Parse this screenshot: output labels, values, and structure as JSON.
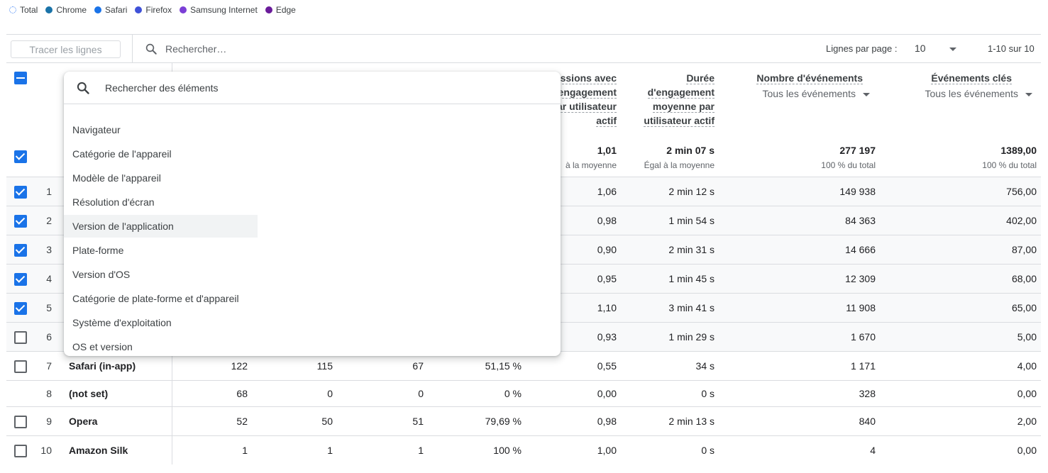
{
  "legend": [
    {
      "label": "Total",
      "color": "#4285f4",
      "style": "dotted"
    },
    {
      "label": "Chrome",
      "color": "#1a73a8"
    },
    {
      "label": "Safari",
      "color": "#1a73e8"
    },
    {
      "label": "Firefox",
      "color": "#3f51d8"
    },
    {
      "label": "Samsung Internet",
      "color": "#7b3fd6"
    },
    {
      "label": "Edge",
      "color": "#6a1b9a"
    }
  ],
  "toolbar": {
    "plot_rows_label": "Tracer les lignes",
    "search_placeholder": "Rechercher…",
    "rows_per_page_label": "Lignes par page :",
    "rows_per_page_value": "10",
    "pagination": "1-10 sur 10"
  },
  "columns": {
    "sessions_per_user": {
      "line1": "essions avec",
      "line2": "engagement",
      "line3": "ar utilisateur",
      "line4": "actif"
    },
    "avg_engagement": {
      "line1": "Durée",
      "line2": "d'engagement",
      "line3": "moyenne par",
      "line4": "utilisateur actif"
    },
    "event_count": {
      "title": "Nombre d'événements",
      "filter": "Tous les événements"
    },
    "key_events": {
      "title": "Événements clés",
      "filter": "Tous les événements"
    }
  },
  "totals": {
    "sessions_per_user": "1,01",
    "sessions_per_user_sub": "à la moyenne",
    "avg_engagement": "2 min 07 s",
    "avg_engagement_sub": "Égal à la moyenne",
    "event_count": "277 197",
    "event_count_sub": "100 % du total",
    "key_events": "1389,00",
    "key_events_sub": "100 % du total"
  },
  "rows": [
    {
      "idx": "1",
      "checked": true,
      "name": "",
      "c1": "",
      "c2": "",
      "c3": "",
      "c4": "",
      "spu": "1,06",
      "eng": "2 min 12 s",
      "events": "149 938",
      "key": "756,00"
    },
    {
      "idx": "2",
      "checked": true,
      "name": "",
      "c1": "",
      "c2": "",
      "c3": "",
      "c4": "",
      "spu": "0,98",
      "eng": "1 min 54 s",
      "events": "84 363",
      "key": "402,00"
    },
    {
      "idx": "3",
      "checked": true,
      "name": "",
      "c1": "",
      "c2": "",
      "c3": "",
      "c4": "",
      "spu": "0,90",
      "eng": "2 min 31 s",
      "events": "14 666",
      "key": "87,00"
    },
    {
      "idx": "4",
      "checked": true,
      "name": "",
      "c1": "",
      "c2": "",
      "c3": "",
      "c4": "",
      "spu": "0,95",
      "eng": "1 min 45 s",
      "events": "12 309",
      "key": "68,00"
    },
    {
      "idx": "5",
      "checked": true,
      "name": "",
      "c1": "",
      "c2": "",
      "c3": "",
      "c4": "",
      "spu": "1,10",
      "eng": "3 min 41 s",
      "events": "11 908",
      "key": "65,00"
    },
    {
      "idx": "6",
      "checked": false,
      "name": "",
      "c1": "",
      "c2": "",
      "c3": "",
      "c4": "",
      "spu": "0,93",
      "eng": "1 min 29 s",
      "events": "1 670",
      "key": "5,00"
    },
    {
      "idx": "7",
      "checked": false,
      "name": "Safari (in-app)",
      "c1": "122",
      "c2": "115",
      "c3": "67",
      "c4": "51,15 %",
      "spu": "0,55",
      "eng": "34 s",
      "events": "1 171",
      "key": "4,00"
    },
    {
      "idx": "8",
      "checked": null,
      "name": "(not set)",
      "c1": "68",
      "c2": "0",
      "c3": "0",
      "c4": "0 %",
      "spu": "0,00",
      "eng": "0 s",
      "events": "328",
      "key": "0,00"
    },
    {
      "idx": "9",
      "checked": false,
      "name": "Opera",
      "c1": "52",
      "c2": "50",
      "c3": "51",
      "c4": "79,69 %",
      "spu": "0,98",
      "eng": "2 min 13 s",
      "events": "840",
      "key": "2,00"
    },
    {
      "idx": "10",
      "checked": false,
      "name": "Amazon Silk",
      "c1": "1",
      "c2": "1",
      "c3": "1",
      "c4": "100 %",
      "spu": "1,00",
      "eng": "0 s",
      "events": "4",
      "key": "0,00"
    }
  ],
  "menu": {
    "search_placeholder": "Rechercher des éléments",
    "items": [
      "Navigateur",
      "Catégorie de l'appareil",
      "Modèle de l'appareil",
      "Résolution d'écran",
      "Version de l'application",
      "Plate-forme",
      "Version d'OS",
      "Catégorie de plate-forme et d'appareil",
      "Système d'exploitation",
      "OS et version"
    ],
    "hovered_index": 4
  }
}
